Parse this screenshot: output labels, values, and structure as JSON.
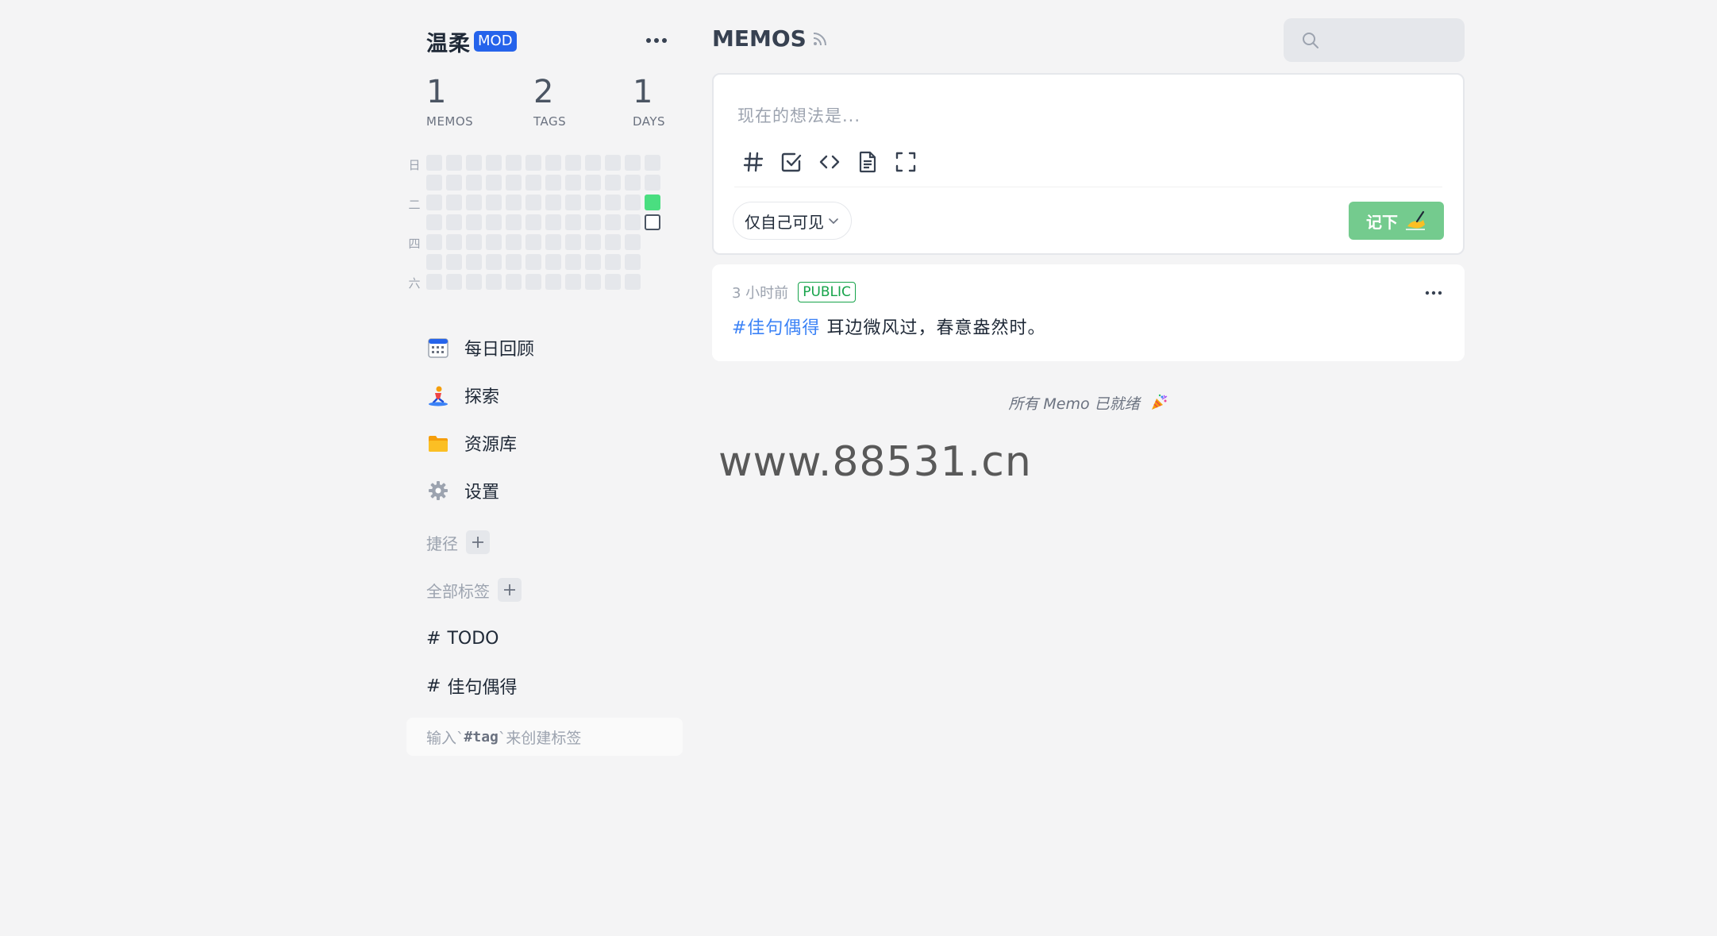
{
  "user": {
    "name": "温柔",
    "role_badge": "MOD"
  },
  "stats": [
    {
      "value": "1",
      "label": "MEMOS"
    },
    {
      "value": "2",
      "label": "TAGS"
    },
    {
      "value": "1",
      "label": "DAYS"
    }
  ],
  "heatmap": {
    "week_labels": [
      "日",
      "二",
      "四",
      "六"
    ]
  },
  "nav": [
    {
      "label": "每日回顾",
      "icon": "calendar-icon"
    },
    {
      "label": "探索",
      "icon": "surfer-icon"
    },
    {
      "label": "资源库",
      "icon": "folder-icon"
    },
    {
      "label": "设置",
      "icon": "gear-icon"
    }
  ],
  "shortcuts": {
    "title": "捷径"
  },
  "tags": {
    "title": "全部标签",
    "items": [
      "TODO",
      "佳句偶得"
    ],
    "hint_prefix": "输入`",
    "hint_code": "#tag",
    "hint_suffix": " `来创建标签"
  },
  "main": {
    "title": "MEMOS",
    "search_placeholder": ""
  },
  "editor": {
    "placeholder": "现在的想法是...",
    "visibility": "仅自己可见",
    "save_label": "记下"
  },
  "memo": {
    "time": "3 小时前",
    "visibility": "PUBLIC",
    "tag": "#佳句偶得",
    "text": "耳边微风过，春意盎然时。"
  },
  "footer": {
    "all_ready": "所有 Memo 已就绪",
    "watermark": "www.88531.cn"
  },
  "colors": {
    "accent_green": "#74cb8e",
    "mod_blue": "#2563eb",
    "tag_blue": "#3b82f6",
    "public_green": "#16a34a",
    "heat_active": "#4ade80"
  }
}
